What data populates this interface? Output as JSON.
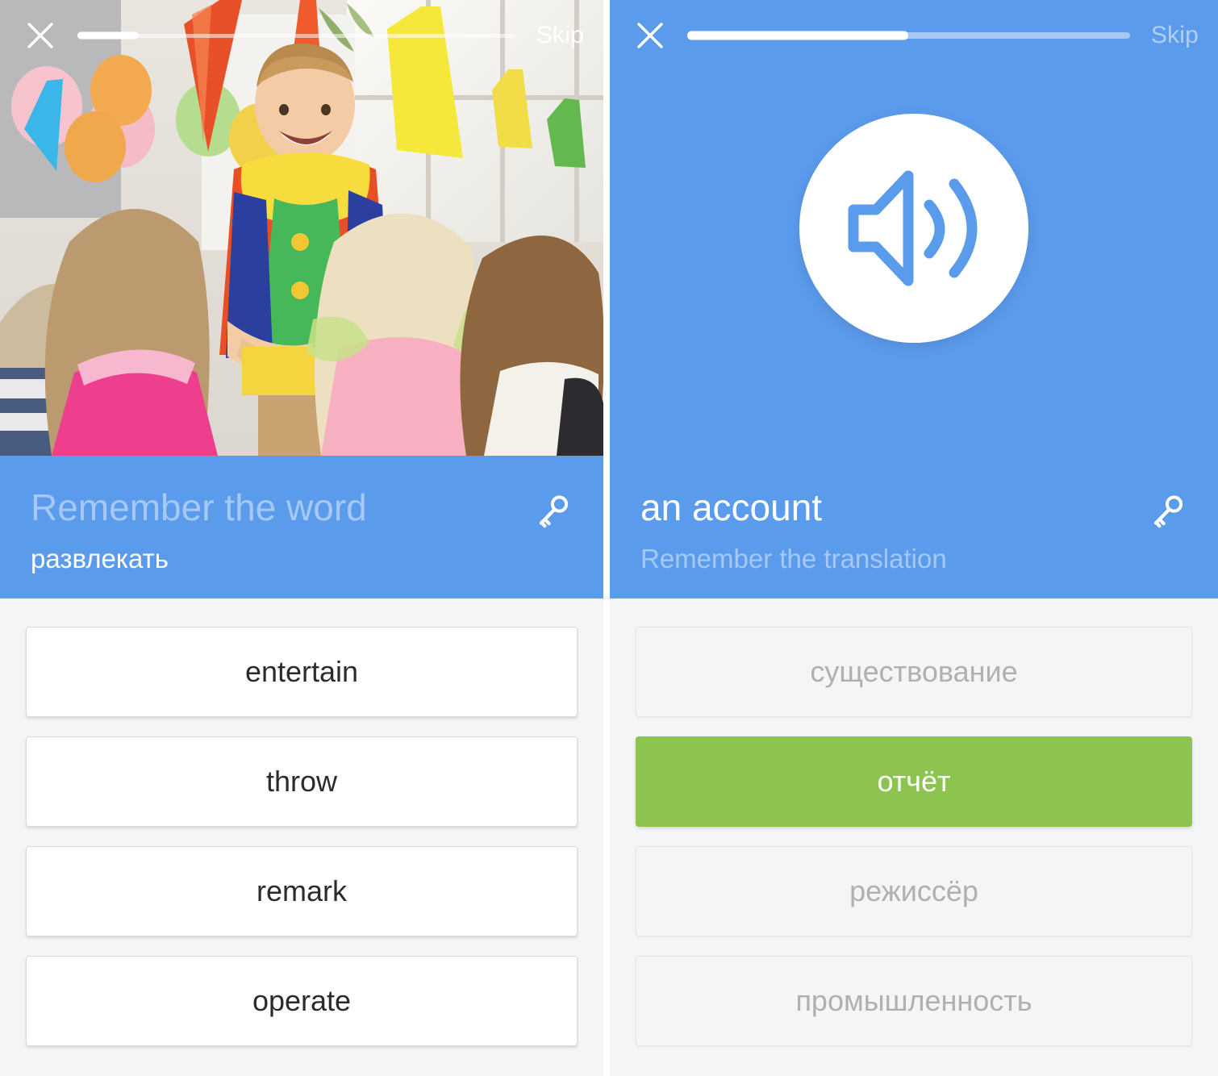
{
  "colors": {
    "brand_blue": "#5b9bec",
    "correct_green": "#8cc44f",
    "page_background": "#f4f5f6",
    "card_white": "#ffffff",
    "card_muted": "#f5f5f5"
  },
  "left_screen": {
    "topbar": {
      "close_icon": "close-icon",
      "skip_label": "Skip",
      "progress_percent": 14
    },
    "hero": {
      "type": "photo",
      "description": "children in party hats around a clown entertainer at a birthday party"
    },
    "prompt": {
      "title": "Remember the word",
      "title_state": "ghost",
      "subtitle": "развлекать",
      "subtitle_state": "solid",
      "key_icon": "key-icon"
    },
    "options": [
      {
        "label": "entertain",
        "state": "plain"
      },
      {
        "label": "throw",
        "state": "plain"
      },
      {
        "label": "remark",
        "state": "plain"
      },
      {
        "label": "operate",
        "state": "plain"
      }
    ]
  },
  "right_screen": {
    "topbar": {
      "close_icon": "close-icon",
      "skip_label": "Skip",
      "progress_percent": 50
    },
    "hero": {
      "type": "audio",
      "audio_icon": "speaker-volume-icon"
    },
    "prompt": {
      "title": "an account",
      "title_state": "solid",
      "subtitle": "Remember the translation",
      "subtitle_state": "ghost",
      "key_icon": "key-icon"
    },
    "options": [
      {
        "label": "существование",
        "state": "muted"
      },
      {
        "label": "отчёт",
        "state": "correct"
      },
      {
        "label": "режиссёр",
        "state": "muted"
      },
      {
        "label": "промышленность",
        "state": "muted"
      }
    ]
  }
}
